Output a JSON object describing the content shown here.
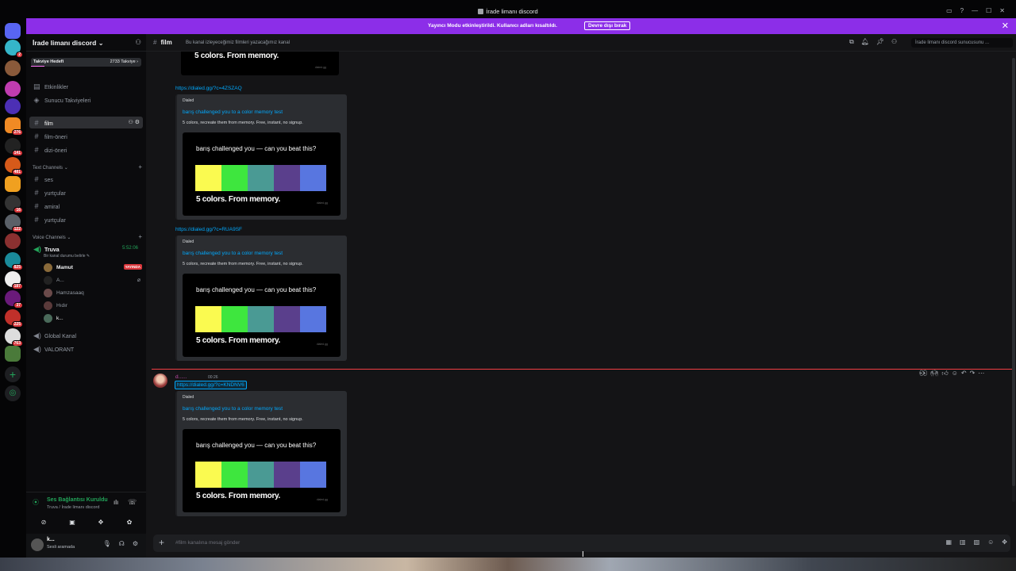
{
  "window": {
    "title": "İrade limanı discord",
    "controls": [
      "▭",
      "?",
      "—",
      "☐",
      "✕"
    ]
  },
  "notice": {
    "text": "Yayıncı Modu etkinleştirildi. Kullanıcı adları kısaltıldı.",
    "button": "Devre dışı bırak",
    "close": "✕"
  },
  "rail": {
    "badges": [
      "2",
      "276",
      "141",
      "481",
      "16",
      "122",
      "825",
      "187",
      "37",
      "225",
      "763"
    ]
  },
  "server": {
    "name": "İrade limanı discord ⌄",
    "boost_label": "Takviye Hedefi",
    "boost_count": "2733 Takviye ›",
    "boost_progress": 0.12
  },
  "events": {
    "label": "Etkinlikler"
  },
  "boosts": {
    "label": "Sunucu Takviyeleri"
  },
  "channels_top": [
    {
      "name": "film"
    },
    {
      "name": "film-öneri"
    },
    {
      "name": "dizi-öneri"
    }
  ],
  "text_category": {
    "label": "Text Channels ⌄",
    "plus": "+"
  },
  "text_channels": [
    {
      "name": "ses"
    },
    {
      "name": "yurtçular"
    },
    {
      "name": "amiral"
    },
    {
      "name": "yurtçular"
    }
  ],
  "voice_category": {
    "label": "Voice Channels ⌄",
    "plus": "+"
  },
  "voice": {
    "channel": "Truva",
    "timer": "5:52:06",
    "status": "Bir kanal durumu belirle ✎",
    "users": [
      {
        "name": "Mamut",
        "live": "YAYINDA"
      },
      {
        "name": "A..."
      },
      {
        "name": "Hamzasaaq"
      },
      {
        "name": "Hıdır"
      },
      {
        "name": "k..."
      }
    ]
  },
  "extra_voice": [
    {
      "name": "Global Kanal"
    },
    {
      "name": "VALORANT"
    }
  ],
  "voice_panel": {
    "status": "Ses Bağlantısı Kuruldu",
    "sub": "Truva / İrade limanı discord"
  },
  "user_panel": {
    "name": "k...",
    "status": "Sesli aramada"
  },
  "header": {
    "channel": "film",
    "topic": "Bu kanal izleyeceğimiz filmleri yazacağımız kanal",
    "search_placeholder": "İrade limanı discord sunucusunu ..."
  },
  "embed_common": {
    "provider": "Dialed",
    "title": "barış challenged you to a color memory test",
    "desc": "5 colors, recreate them from memory. Free, instant, no signup.",
    "img_head": "barış challenged you — can you beat this?",
    "img_foot": "5 colors. From memory.",
    "img_mark": "dialed.gg",
    "swatches": [
      "#fafa50",
      "#3ee63e",
      "#4a9a94",
      "#5a3f8c",
      "#5876e0"
    ]
  },
  "messages": {
    "link1": "https://dialed.gg/?c=4ZSZAQ",
    "link2": "https://dialed.gg/?c=RUA9SF",
    "link3": "https://dialed.gg/?c=KNDNV6",
    "top_foot": "5 colors. From memory."
  },
  "new_message": {
    "author": "d......",
    "timestamp": "00:26"
  },
  "composer": {
    "placeholder": "#film kanalına mesaj gönder",
    "plus": "+"
  }
}
